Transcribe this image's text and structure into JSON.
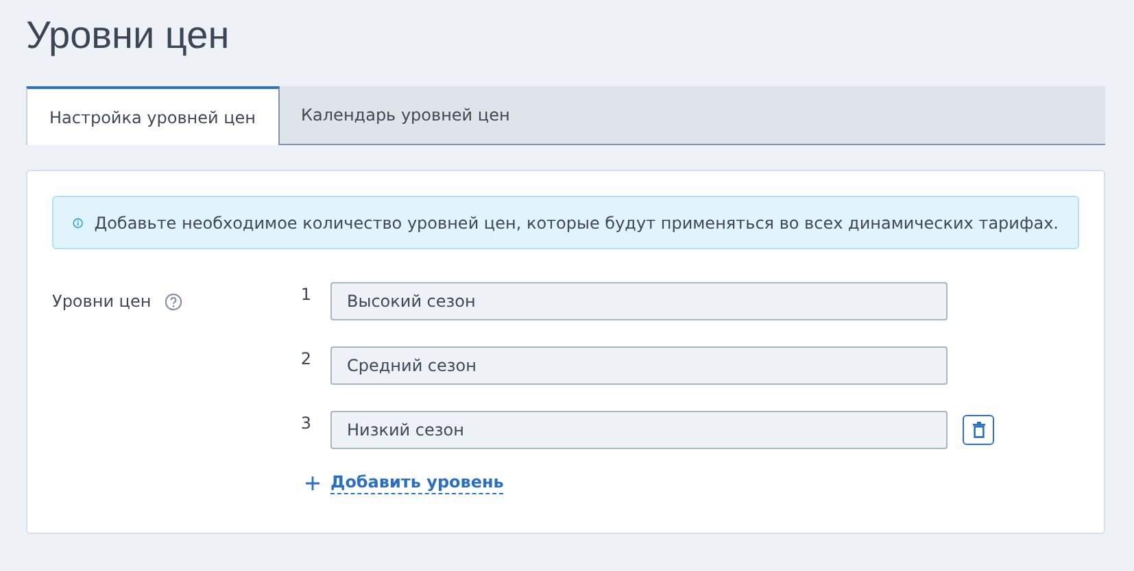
{
  "page_title": "Уровни цен",
  "tabs": [
    {
      "label": "Настройка уровней цен",
      "selected": true
    },
    {
      "label": "Календарь уровней цен",
      "selected": false
    }
  ],
  "info_alert": "Добавьте необходимое количество уровней цен, которые будут применяться во всех динамических тарифах.",
  "levels_field": {
    "label": "Уровни цен",
    "levels": [
      {
        "number": "1",
        "value": "Высокий сезон",
        "deletable": false
      },
      {
        "number": "2",
        "value": "Средний сезон",
        "deletable": false
      },
      {
        "number": "3",
        "value": "Низкий сезон",
        "deletable": true
      }
    ]
  },
  "add_level_link": "Добавить уровень"
}
